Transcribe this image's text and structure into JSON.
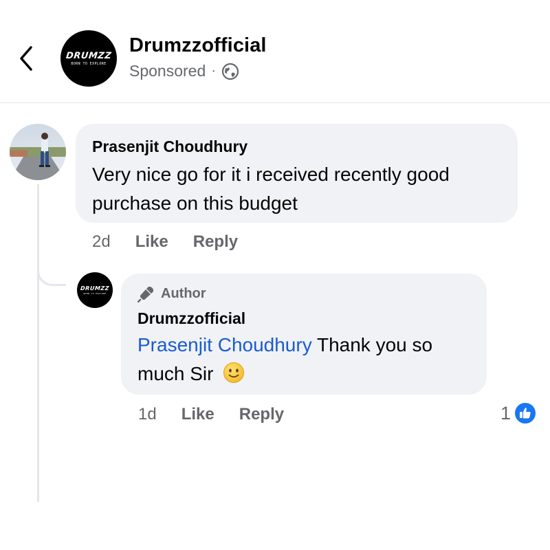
{
  "header": {
    "page_name": "Drumzzofficial",
    "sponsored": "Sponsored",
    "separator": "·",
    "logo_main": "DRUMZZ",
    "logo_sub": "BORN TO EXPLORE"
  },
  "comments": [
    {
      "author": "Prasenjit Choudhury",
      "text": "Very nice go for it i received recently good purchase on this budget",
      "time": "2d",
      "like_label": "Like",
      "reply_label": "Reply"
    }
  ],
  "reply": {
    "badge": "Author",
    "author": "Drumzzofficial",
    "mention": "Prasenjit Choudhury",
    "text": "Thank you so much Sir",
    "time": "1d",
    "like_label": "Like",
    "reply_label": "Reply",
    "reaction_count": "1",
    "logo_main": "DRUMZZ",
    "logo_sub": "BORN TO EXPLORE"
  },
  "colors": {
    "accent": "#1877f2",
    "mention": "#1a5bd1",
    "bubble": "#f0f2f5",
    "secondary_text": "#65676b"
  },
  "icons": {
    "back": "chevron-left-icon",
    "globe": "globe-icon",
    "author": "microphone-icon",
    "reaction": "thumbs-up-icon",
    "emoji": "slightly-smiling-face-icon"
  }
}
